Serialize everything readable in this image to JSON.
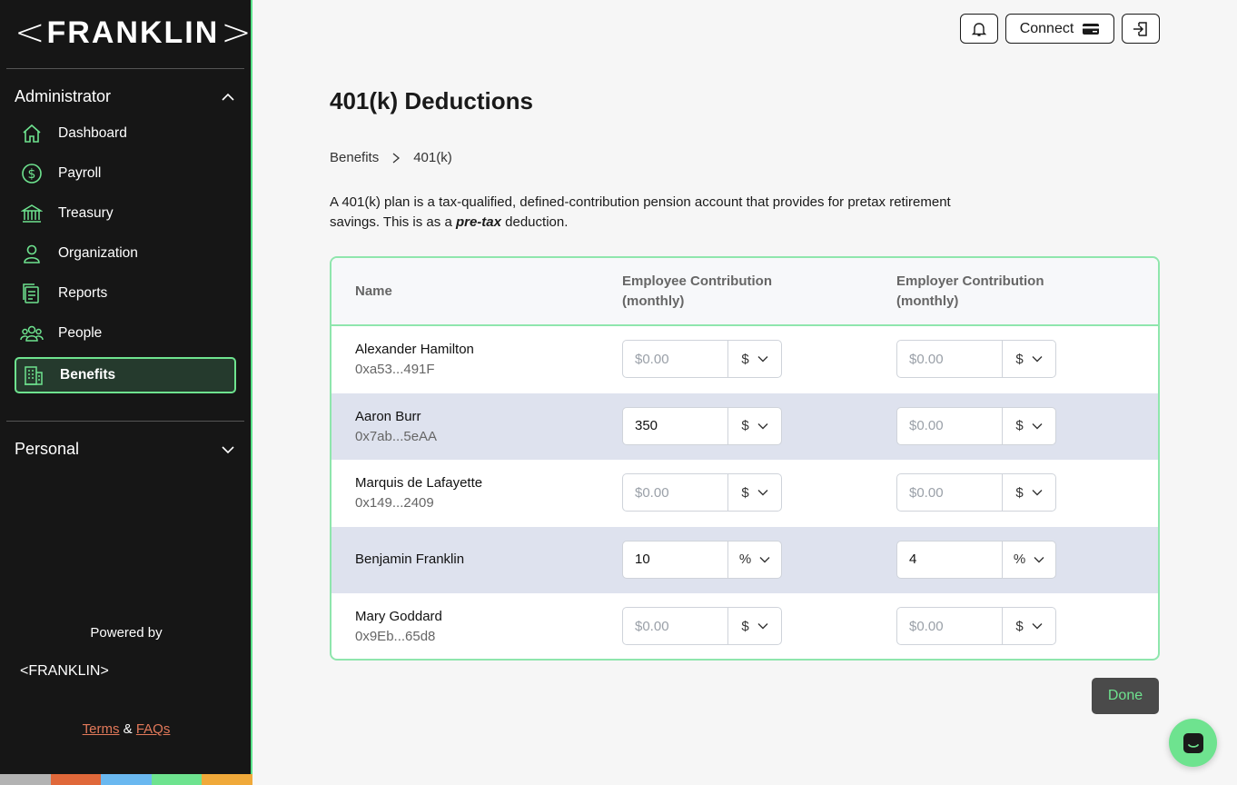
{
  "brand": {
    "name": "FRANKLIN"
  },
  "sidebar": {
    "admin_section": "Administrator",
    "items": [
      {
        "label": "Dashboard",
        "icon": "home-icon"
      },
      {
        "label": "Payroll",
        "icon": "dollar-icon"
      },
      {
        "label": "Treasury",
        "icon": "bank-icon"
      },
      {
        "label": "Organization",
        "icon": "user-icon"
      },
      {
        "label": "Reports",
        "icon": "reports-icon"
      },
      {
        "label": "People",
        "icon": "people-icon"
      },
      {
        "label": "Benefits",
        "icon": "building-icon",
        "active": true
      }
    ],
    "personal_section": "Personal",
    "powered_by": "Powered by",
    "terms_link": "Terms",
    "amp": "&",
    "faqs_link": "FAQs",
    "color_bar": [
      "#b3b3b3",
      "#e0683a",
      "#6ab8f0",
      "#6ee38f",
      "#f0a93a"
    ]
  },
  "header": {
    "connect_label": "Connect"
  },
  "main": {
    "title": "401(k) Deductions",
    "breadcrumb": [
      "Benefits",
      "401(k)"
    ],
    "description_part1": "A 401(k) plan is a tax-qualified, defined-contribution pension account that provides for pretax retirement savings. This is as a ",
    "description_emphasis": "pre-tax",
    "description_part2": " deduction.",
    "table": {
      "columns": {
        "name": "Name",
        "employee_line1": "Employee Contribution",
        "employee_line2": "(monthly)",
        "employer_line1": "Employer Contribution",
        "employer_line2": "(monthly)"
      },
      "placeholder": "$0.00",
      "rows": [
        {
          "name": "Alexander Hamilton",
          "address": "0xa53...491F",
          "employee_value": "",
          "employee_unit": "$",
          "employer_value": "",
          "employer_unit": "$"
        },
        {
          "name": "Aaron Burr",
          "address": "0x7ab...5eAA",
          "employee_value": "350",
          "employee_unit": "$",
          "employer_value": "",
          "employer_unit": "$"
        },
        {
          "name": "Marquis de Lafayette",
          "address": "0x149...2409",
          "employee_value": "",
          "employee_unit": "$",
          "employer_value": "",
          "employer_unit": "$"
        },
        {
          "name": "Benjamin Franklin",
          "address": "",
          "employee_value": "10",
          "employee_unit": "%",
          "employer_value": "4",
          "employer_unit": "%"
        },
        {
          "name": "Mary Goddard",
          "address": "0x9Eb...65d8",
          "employee_value": "",
          "employee_unit": "$",
          "employer_value": "",
          "employer_unit": "$"
        }
      ]
    },
    "done_label": "Done"
  },
  "colors": {
    "accent": "#6ee38f",
    "sidebar_bg": "#161616",
    "row_shade": "#dee2ee"
  }
}
